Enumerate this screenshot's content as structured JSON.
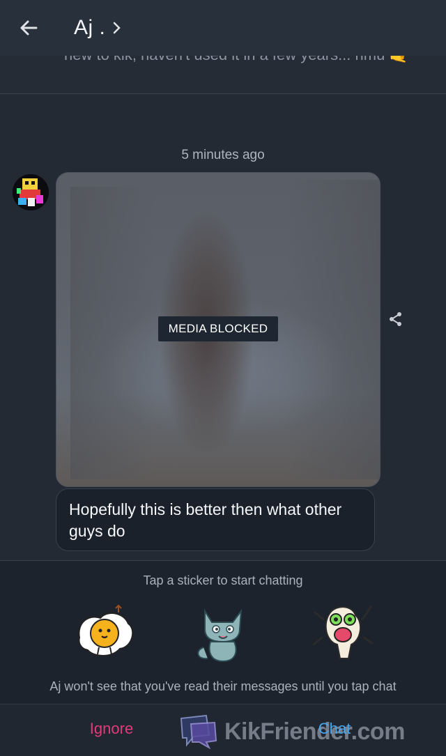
{
  "header": {
    "title": "Aj ."
  },
  "previous_message": {
    "text": "new to kik, haven't used it in a few years... hmu 🤙"
  },
  "conversation": {
    "timestamp": "5 minutes ago",
    "media_label": "MEDIA BLOCKED",
    "message": "Hopefully this is better then what other guys do"
  },
  "sticker_panel": {
    "hint": "Tap a sticker to start chatting",
    "stickers": [
      "egg-sticker",
      "cat-sticker",
      "creature-sticker"
    ],
    "read_note": "Aj won't see that you've read their messages until you tap chat"
  },
  "actions": {
    "ignore_label": "Ignore",
    "chat_label": "Chat"
  },
  "watermark": {
    "text": "KikFriender.com"
  },
  "colors": {
    "ignore": "#e23a7b",
    "chat": "#45a7f0",
    "background": "#232a34"
  }
}
